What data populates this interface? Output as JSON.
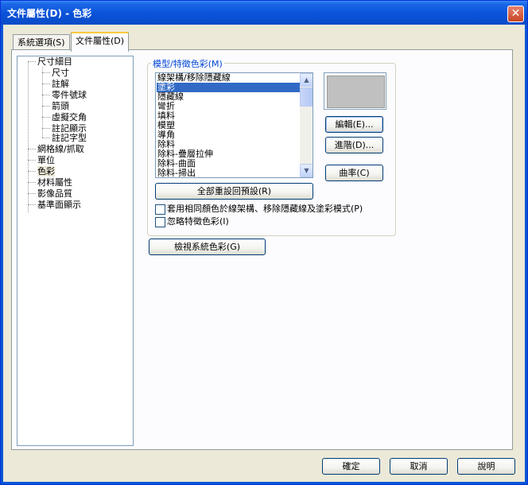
{
  "window": {
    "title": "文件屬性(D) - 色彩"
  },
  "tabs": [
    {
      "label": "系統選項(S)"
    },
    {
      "label": "文件屬性(D)"
    }
  ],
  "tree": {
    "items": [
      {
        "label": "尺寸細目"
      },
      {
        "label": "尺寸"
      },
      {
        "label": "註解"
      },
      {
        "label": "零件號球"
      },
      {
        "label": "箭頭"
      },
      {
        "label": "虛擬交角"
      },
      {
        "label": "註記顯示"
      },
      {
        "label": "註記字型"
      },
      {
        "label": "網格線/抓取"
      },
      {
        "label": "單位"
      },
      {
        "label": "色彩"
      },
      {
        "label": "材料屬性"
      },
      {
        "label": "影像品質"
      },
      {
        "label": "基準面顯示"
      }
    ]
  },
  "color_group": {
    "label": "模型/特徵色彩(M)",
    "list_items": [
      "線架構/移除隱藏線",
      "塗彩",
      "隱藏線",
      "彎折",
      "填料",
      "模塑",
      "導角",
      "除料",
      "除料-疊層拉伸",
      "除料-曲面",
      "除料-掃出"
    ],
    "selected_item": "塗彩",
    "swatch_color": "#c0c0c0",
    "edit_button": "編輯(E)...",
    "advanced_button": "進階(D)...",
    "curvature_button": "曲率(C)",
    "reset_button": "全部重設回預設(R)",
    "check_same_color": "套用相同顏色於線架構、移除隱藏線及塗彩模式(P)",
    "check_ignore": "忽略特徵色彩(I)"
  },
  "view_system_colors_button": "檢視系統色彩(G)",
  "footer": {
    "ok": "確定",
    "cancel": "取消",
    "help": "說明"
  },
  "icons": {
    "close": "close-icon",
    "scroll_up": "scroll-up-icon",
    "scroll_down": "scroll-down-icon"
  }
}
